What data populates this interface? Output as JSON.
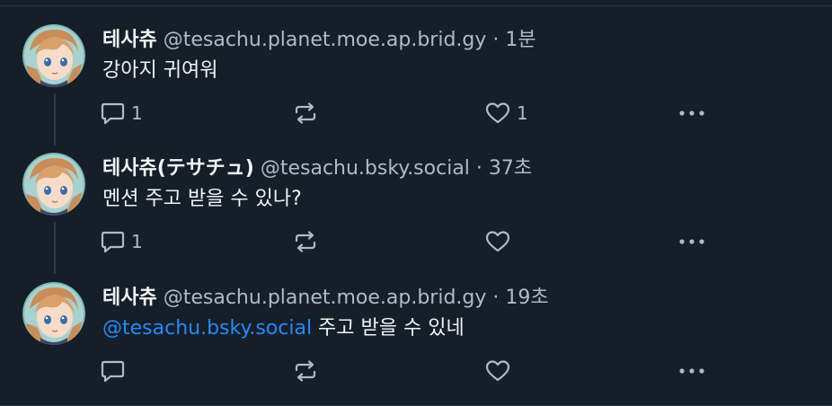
{
  "posts": [
    {
      "author_name": "테사츄",
      "handle": "@tesachu.planet.moe.ap.brid.gy",
      "separator": "·",
      "time": "1분",
      "text": "강아지 귀여워",
      "mention": "",
      "reply_count": "1",
      "repost_count": "",
      "like_count": "1"
    },
    {
      "author_name": "테사츄(テサチュ)",
      "handle": "@tesachu.bsky.social",
      "separator": "·",
      "time": "37초",
      "text": "멘션 주고 받을 수 있나?",
      "mention": "",
      "reply_count": "1",
      "repost_count": "",
      "like_count": ""
    },
    {
      "author_name": "테사츄",
      "handle": "@tesachu.planet.moe.ap.brid.gy",
      "separator": "·",
      "time": "19초",
      "text": " 주고 받을 수 있네",
      "mention": "@tesachu.bsky.social",
      "reply_count": "",
      "repost_count": "",
      "like_count": ""
    }
  ],
  "icons": {
    "reply": "comment-bubble-icon",
    "repost": "repost-arrows-icon",
    "like": "heart-icon",
    "more": "ellipsis-icon",
    "avatar": "anime-avatar-image"
  },
  "colors": {
    "background": "#161e27",
    "text_primary": "#f1f3f5",
    "text_secondary": "#aebbc9",
    "mention": "#208bfe",
    "divider": "#2c3947"
  }
}
